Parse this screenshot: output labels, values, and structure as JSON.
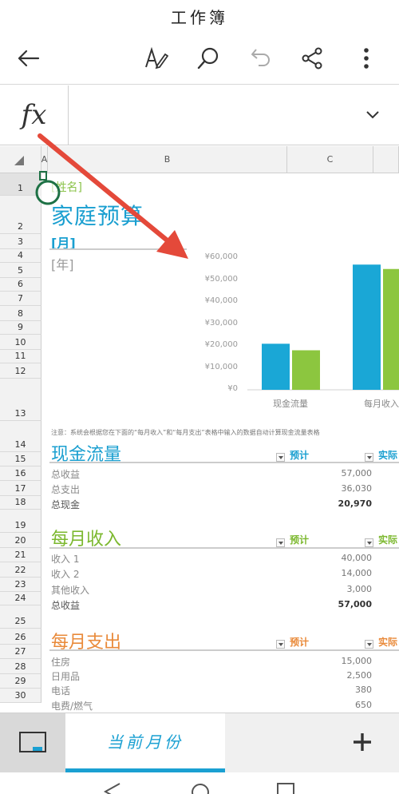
{
  "app": {
    "title": "工作簿"
  },
  "formula_bar": {
    "fx_label": "fx",
    "value": ""
  },
  "columns": [
    "A",
    "B",
    "C"
  ],
  "rows": [
    "1",
    "2",
    "3",
    "4",
    "5",
    "6",
    "7",
    "8",
    "9",
    "10",
    "11",
    "12",
    "13",
    "14",
    "15",
    "16",
    "17",
    "18",
    "19",
    "20",
    "21",
    "22",
    "23",
    "24",
    "25",
    "26",
    "27",
    "28",
    "29",
    "30"
  ],
  "sheet": {
    "name_cell": "[姓名]",
    "title": "家庭预算",
    "month": "[月]",
    "year": "[年]",
    "note": "注意：系统会根据您在下面的“每月收入”和“每月支出”表格中输入的数据自动计算现金流量表格"
  },
  "cashflow": {
    "title": "现金流量",
    "planned": "预计",
    "actual": "实际",
    "rows": [
      {
        "label": "总收益",
        "value": "57,000"
      },
      {
        "label": "总支出",
        "value": "36,030"
      },
      {
        "label": "总现金",
        "value": "20,970"
      }
    ]
  },
  "income": {
    "title": "每月收入",
    "planned": "预计",
    "actual": "实际",
    "rows": [
      {
        "label": "收入 1",
        "value": "40,000"
      },
      {
        "label": "收入 2",
        "value": "14,000"
      },
      {
        "label": "其他收入",
        "value": "3,000"
      },
      {
        "label": "总收益",
        "value": "57,000"
      }
    ]
  },
  "expenses": {
    "title": "每月支出",
    "planned": "预计",
    "actual": "实际",
    "rows": [
      {
        "label": "住房",
        "value": "15,000"
      },
      {
        "label": "日用品",
        "value": "2,500"
      },
      {
        "label": "电话",
        "value": "380"
      },
      {
        "label": "电费/燃气",
        "value": "650"
      }
    ]
  },
  "chart_data": {
    "type": "bar",
    "categories": [
      "现金流量",
      "每月收入"
    ],
    "series": [
      {
        "values": [
          20970,
          57000
        ]
      },
      {
        "values": [
          18000,
          55000
        ]
      }
    ],
    "y_ticks": [
      "¥60,000",
      "¥50,000",
      "¥40,000",
      "¥30,000",
      "¥20,000",
      "¥10,000",
      "¥0"
    ],
    "ylim": [
      0,
      60000
    ],
    "grid": false,
    "colors": [
      "#1aa7d6",
      "#8cc63f"
    ]
  },
  "sheet_tabs": {
    "active": "当前月份"
  },
  "colors": {
    "blue": "#1a9fd0",
    "green": "#7cb82f",
    "orange": "#e98a3a",
    "arrow": "#e4493a"
  }
}
